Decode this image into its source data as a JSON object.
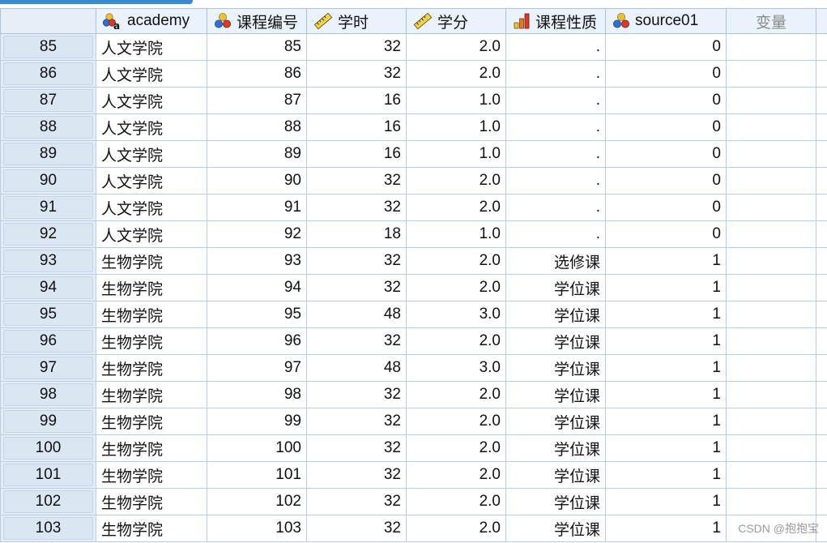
{
  "columns": [
    {
      "label": "academy",
      "icon": "nominal-string-icon"
    },
    {
      "label": "课程编号",
      "icon": "nominal-icon"
    },
    {
      "label": "学时",
      "icon": "scale-icon"
    },
    {
      "label": "学分",
      "icon": "scale-icon"
    },
    {
      "label": "课程性质",
      "icon": "ordinal-icon"
    },
    {
      "label": "source01",
      "icon": "nominal-icon"
    },
    {
      "label": "变量",
      "icon": ""
    }
  ],
  "rows": [
    {
      "row": "85",
      "academy": "人文学院",
      "code": "85",
      "hours": "32",
      "credit": "2.0",
      "nature": ".",
      "source": "0"
    },
    {
      "row": "86",
      "academy": "人文学院",
      "code": "86",
      "hours": "32",
      "credit": "2.0",
      "nature": ".",
      "source": "0"
    },
    {
      "row": "87",
      "academy": "人文学院",
      "code": "87",
      "hours": "16",
      "credit": "1.0",
      "nature": ".",
      "source": "0"
    },
    {
      "row": "88",
      "academy": "人文学院",
      "code": "88",
      "hours": "16",
      "credit": "1.0",
      "nature": ".",
      "source": "0"
    },
    {
      "row": "89",
      "academy": "人文学院",
      "code": "89",
      "hours": "16",
      "credit": "1.0",
      "nature": ".",
      "source": "0"
    },
    {
      "row": "90",
      "academy": "人文学院",
      "code": "90",
      "hours": "32",
      "credit": "2.0",
      "nature": ".",
      "source": "0"
    },
    {
      "row": "91",
      "academy": "人文学院",
      "code": "91",
      "hours": "32",
      "credit": "2.0",
      "nature": ".",
      "source": "0"
    },
    {
      "row": "92",
      "academy": "人文学院",
      "code": "92",
      "hours": "18",
      "credit": "1.0",
      "nature": ".",
      "source": "0"
    },
    {
      "row": "93",
      "academy": "生物学院",
      "code": "93",
      "hours": "32",
      "credit": "2.0",
      "nature": "选修课",
      "source": "1"
    },
    {
      "row": "94",
      "academy": "生物学院",
      "code": "94",
      "hours": "32",
      "credit": "2.0",
      "nature": "学位课",
      "source": "1"
    },
    {
      "row": "95",
      "academy": "生物学院",
      "code": "95",
      "hours": "48",
      "credit": "3.0",
      "nature": "学位课",
      "source": "1"
    },
    {
      "row": "96",
      "academy": "生物学院",
      "code": "96",
      "hours": "32",
      "credit": "2.0",
      "nature": "学位课",
      "source": "1"
    },
    {
      "row": "97",
      "academy": "生物学院",
      "code": "97",
      "hours": "48",
      "credit": "3.0",
      "nature": "学位课",
      "source": "1"
    },
    {
      "row": "98",
      "academy": "生物学院",
      "code": "98",
      "hours": "32",
      "credit": "2.0",
      "nature": "学位课",
      "source": "1"
    },
    {
      "row": "99",
      "academy": "生物学院",
      "code": "99",
      "hours": "32",
      "credit": "2.0",
      "nature": "学位课",
      "source": "1"
    },
    {
      "row": "100",
      "academy": "生物学院",
      "code": "100",
      "hours": "32",
      "credit": "2.0",
      "nature": "学位课",
      "source": "1"
    },
    {
      "row": "101",
      "academy": "生物学院",
      "code": "101",
      "hours": "32",
      "credit": "2.0",
      "nature": "学位课",
      "source": "1"
    },
    {
      "row": "102",
      "academy": "生物学院",
      "code": "102",
      "hours": "32",
      "credit": "2.0",
      "nature": "学位课",
      "source": "1"
    },
    {
      "row": "103",
      "academy": "生物学院",
      "code": "103",
      "hours": "32",
      "credit": "2.0",
      "nature": "学位课",
      "source": "1"
    }
  ],
  "watermark": "CSDN @抱抱宝",
  "colors": {
    "header_bg": "#eaf2fb",
    "grid_line": "#b8cee3",
    "row_header_bg": "#dbe6f3"
  }
}
